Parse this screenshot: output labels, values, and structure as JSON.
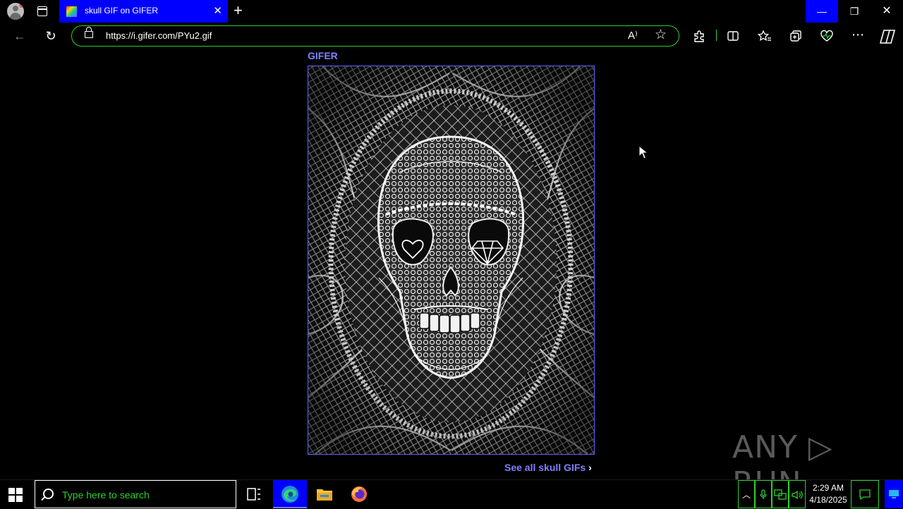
{
  "browser": {
    "tab": {
      "title": "skull GIF on GIFER",
      "close_glyph": "✕"
    },
    "new_tab_glyph": "+",
    "window_buttons": {
      "minimize": "—",
      "maximize": "❐",
      "close": "✕"
    },
    "address_bar": {
      "url": "https://i.gifer.com/PYu2.gif"
    },
    "nav": {
      "back": "←",
      "refresh": "↻"
    },
    "toolbar_icons": [
      "read-aloud-icon",
      "favorite-star-icon",
      "extensions-icon",
      "split-screen-icon",
      "favorites-icon",
      "collections-icon",
      "browser-essentials-icon",
      "more-icon",
      "copilot-icon"
    ],
    "accent_color": "#2bd12b",
    "tab_color": "#0000ff"
  },
  "page": {
    "brand": "GIFER",
    "image_subject": "skull",
    "see_all_label": "See all skull GIFs",
    "see_all_chevron": "›",
    "link_color": "#8080ff",
    "watermark": "ANY ▷ RUN"
  },
  "taskbar": {
    "search_placeholder": "Type here to search",
    "apps": [
      "task-view-icon",
      "edge-icon",
      "file-explorer-icon",
      "firefox-icon"
    ],
    "clock": {
      "time": "2:29 AM",
      "date": "4/18/2025"
    }
  }
}
